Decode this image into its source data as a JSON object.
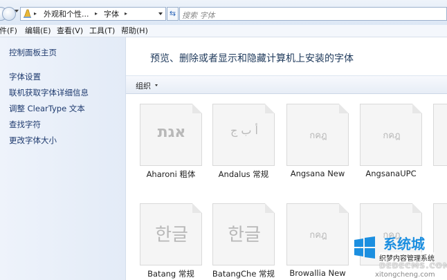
{
  "address": {
    "crumbs": [
      "外观和个性...",
      "字体"
    ],
    "search_placeholder": "搜索 字体"
  },
  "menu": [
    "文件(F)",
    "编辑(E)",
    "查看(V)",
    "工具(T)",
    "帮助(H)"
  ],
  "left_pane": {
    "home": "控制面板主页",
    "links": [
      "字体设置",
      "联机获取字体详细信息",
      "调整 ClearType 文本",
      "查找字符",
      "更改字体大小"
    ]
  },
  "main": {
    "title": "预览、删除或者显示和隐藏计算机上安装的字体",
    "organize": "组织",
    "fonts": [
      {
        "name": "Aharoni 粗体",
        "glyph": "אגת"
      },
      {
        "name": "Andalus 常规",
        "glyph": "أ ب ج"
      },
      {
        "name": "Angsana New",
        "glyph": "กคฎ"
      },
      {
        "name": "AngsanaUPC",
        "glyph": "กคฎ"
      },
      {
        "name": "Batang 常规",
        "glyph": "한글"
      },
      {
        "name": "BatangChe 常规",
        "glyph": "한글"
      },
      {
        "name": "Browallia New",
        "glyph": "กคฎ"
      },
      {
        "name": "",
        "glyph": "กคฎ"
      }
    ]
  },
  "watermark": {
    "brand": "系统城",
    "line1": "织梦内容管理系统",
    "line2": "DEDECMS.COM",
    "line3": "xitongcheng.com"
  }
}
